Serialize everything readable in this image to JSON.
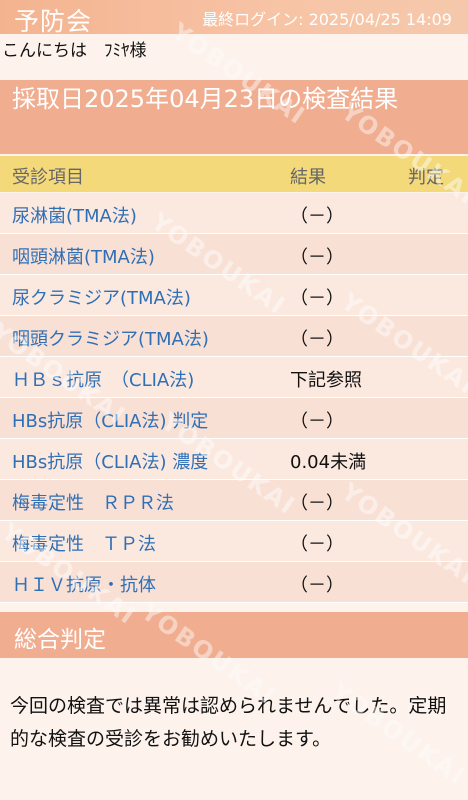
{
  "header": {
    "logo": "予防会",
    "last_login": "最終ログイン: 2025/04/25 14:09"
  },
  "greeting": "こんにちは　ﾌﾐﾔ様",
  "result_title": "採取日2025年04月23日の検査結果",
  "table": {
    "columns": [
      "受診項目",
      "結果",
      "判定"
    ],
    "rows": [
      {
        "item": "尿淋菌(TMA法)",
        "result": "（－）"
      },
      {
        "item": "咽頭淋菌(TMA法)",
        "result": "（－）"
      },
      {
        "item": "尿クラミジア(TMA法)",
        "result": "（－）"
      },
      {
        "item": "咽頭クラミジア(TMA法)",
        "result": "（－）"
      },
      {
        "item": "ＨＢｓ抗原　（CLIA法)",
        "result": "下記参照"
      },
      {
        "item": "HBs抗原（CLIA法) 判定",
        "result": "（－）"
      },
      {
        "item": "HBs抗原（CLIA法) 濃度",
        "result": "0.04未満"
      },
      {
        "item": "梅毒定性　ＲＰＲ法",
        "result": "（－）"
      },
      {
        "item": "梅毒定性　ＴＰ法",
        "result": "（－）"
      },
      {
        "item": "ＨＩＶ抗原・抗体",
        "result": "（－）"
      }
    ]
  },
  "summary": {
    "title": "総合判定",
    "text": "今回の検査では異常は認められませんでした。定期的な検査の受診をお勧めいたします。"
  },
  "watermark": "YOBOUKAI"
}
